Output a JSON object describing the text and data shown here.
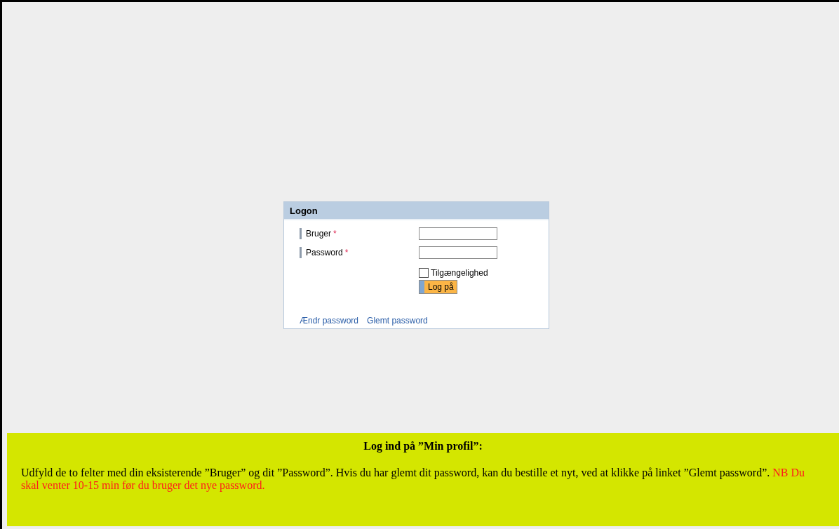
{
  "logon": {
    "title": "Logon",
    "fields": [
      {
        "label": "Bruger",
        "required_mark": "*"
      },
      {
        "label": "Password",
        "required_mark": "*"
      }
    ],
    "checkbox": {
      "label": "Tilgængelighed",
      "checked": false
    },
    "button": "Log på",
    "links": [
      "Ændr password",
      "Glemt password"
    ]
  },
  "info": {
    "heading": "Log ind på ”Min profil”:",
    "text": "Udfyld de to felter med din eksisterende ”Bruger” og dit ”Password”. Hvis du har glemt dit password, kan du bestille et nyt, ved at klikke på linket ”Glemt password”.",
    "note": "NB Du skal venter 10-15 min før du bruger det nye password."
  }
}
